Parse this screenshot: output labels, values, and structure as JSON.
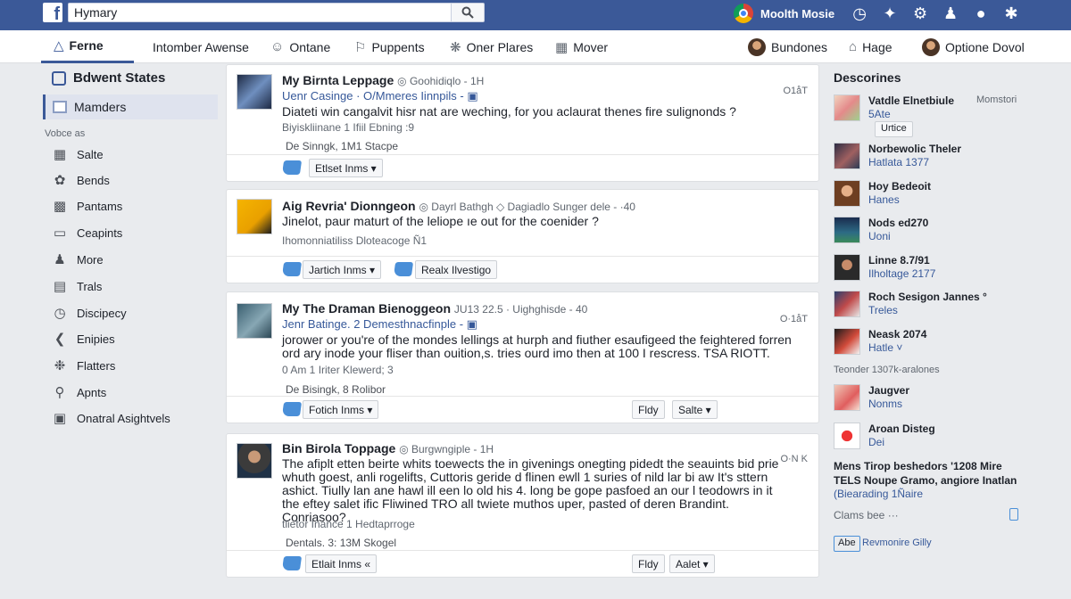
{
  "colors": {
    "brand": "#3b5998",
    "link": "#365899",
    "like": "#4a8fd8",
    "bg": "#e9ebee"
  },
  "topbar": {
    "logo": "f",
    "search_value": "Hymary",
    "user_name": "Moolth Mosie",
    "icons": [
      "chrome-icon",
      "globe-icon",
      "twitter-icon",
      "gear-icon",
      "person-icon",
      "dots-icon",
      "notification-icon"
    ]
  },
  "nav": {
    "items": [
      {
        "label": "Ferne",
        "icon": "home-icon"
      },
      {
        "label": "Intomber Awense",
        "icon": "none"
      },
      {
        "label": "Ontane",
        "icon": "smile-icon"
      },
      {
        "label": "Puppents",
        "icon": "puzzle-icon"
      },
      {
        "label": "Oner Plares",
        "icon": "spark-icon"
      },
      {
        "label": "Mover",
        "icon": "bookmark-icon"
      }
    ],
    "right": [
      {
        "label": "Bundones",
        "icon": "avatar"
      },
      {
        "label": "Hage",
        "icon": "house-icon"
      },
      {
        "label": "Optione Dovol",
        "icon": "avatar"
      }
    ]
  },
  "sidebar": {
    "heading": "Bdwent States",
    "active": "Mamders",
    "section": "Vobce as",
    "items": [
      {
        "label": "Salte",
        "icon": "grid-icon"
      },
      {
        "label": "Bends",
        "icon": "bird-icon"
      },
      {
        "label": "Pantams",
        "icon": "card-icon"
      },
      {
        "label": "Ceapints",
        "icon": "layers-icon"
      },
      {
        "label": "More",
        "icon": "people-icon"
      },
      {
        "label": "Trals",
        "icon": "chart-icon"
      },
      {
        "label": "Discipecy",
        "icon": "clock-icon"
      },
      {
        "label": "Enipies",
        "icon": "arrow-icon"
      },
      {
        "label": "Flatters",
        "icon": "flower-icon"
      },
      {
        "label": "Apnts",
        "icon": "user-icon"
      },
      {
        "label": "Onatral Asightvels",
        "icon": "tray-icon"
      }
    ]
  },
  "posts": [
    {
      "title": "My Birnta Leppage",
      "meta": "◎ Goohidiqlo - 1H",
      "sub": "Uenr Casinge · O/Mmeres Iinnpils - ▣",
      "body": "Diateti win cangalvit hisr nat are weching, for you aclaurat thenes fire sulignonds ?",
      "line1": "Biyiskliinane   1 Ifiil Ebning :9",
      "line2": "De Sinngk,   1M1 Stacpe",
      "time": "O1åT",
      "buttons": [
        "Etlset Inms ▾"
      ]
    },
    {
      "title": "Aig Revria' Dionngeon",
      "meta": "◎ Dayrl Bathgh ◇ Dagiadlo Sunger dele - ·40",
      "sub": "",
      "body": "Jinelot, paur maturt of the leliope ıе out for the coenider ?",
      "line1": "Ihomonniatiliss   Dloteacoge Ñ1",
      "line2": "",
      "time": "",
      "buttons": [
        "Jartich Inms ▾",
        "Realx Ilvestigo"
      ]
    },
    {
      "title": "My The Draman Bienoggeon",
      "meta": "JU13 22.5 · Uighghisde - 40",
      "sub": "Jenr Batinge. 2 Demesthnacfinple - ▣",
      "body": "jorower or you're of the mondes lellings at hurph and fiuther esaufigeed the feightered forren ord ary inode your fliser than ouition,s. tries ourd imo then at 100 I rescress. TSA RIOTT.",
      "line1": "0 Am 1   Iriter Klewerd;   3",
      "line2": "De Bisingk,   8 Rolibor",
      "time": "O·1åT",
      "buttons": [
        "Fotich Inms ▾",
        "Fldy",
        "Salte ▾"
      ]
    },
    {
      "title": "Bin Birola Toppage",
      "meta": "◎ Burgwngiple - 1H",
      "sub": "",
      "body": "The afiplt etten beirte whits toewects the in givenings onegting pidedt the seauints bid prie whuth goest, anli rogelifts, Cuttoris geride d flinen ewll 1 suries of nild lar bi aw It's sttern ashict. Tiully lan ane hawl ill een lo old his 4. long be gope pasfoed an our l teodowrs in it the eftey salet ific Fliwined TRO all twiete muthos uper, pasted of deren Brandint. Conriasoo?",
      "line1": "tlietor Inance   1 Hedtaprroge",
      "line2": "Dentals.   3:   13M Skogel",
      "time": "O·N K",
      "buttons": [
        "Etlait Inms «",
        "Fldy",
        "Aalet ▾"
      ]
    }
  ],
  "right": {
    "title": "Descorines",
    "items": [
      {
        "name": "Vatdle Elnetbiule",
        "sub": "5Ate",
        "extra": "Momstori",
        "button": "Urtice"
      },
      {
        "name": "Norbewolic Theler",
        "sub": "Hatlata 1377",
        "extra": "",
        "button": ""
      },
      {
        "name": "Hoy Bedeoit",
        "sub": "Hanes",
        "extra": "",
        "button": ""
      },
      {
        "name": "Nods ed270",
        "sub": "Uoni",
        "extra": "",
        "button": ""
      },
      {
        "name": "Linne 8.7/91",
        "sub": "Ilholtage 2177",
        "extra": "",
        "button": ""
      },
      {
        "name": "Roch Sesigon Jannes °",
        "sub": "Treles",
        "extra": "",
        "button": ""
      },
      {
        "name": "Neask 2074",
        "sub": "Hatle ˅",
        "extra": "",
        "button": ""
      }
    ],
    "section": "Teonder 1307k-aralones",
    "items2": [
      {
        "name": "Jaugver",
        "sub": "Nonms"
      },
      {
        "name": "Aroan Disteg",
        "sub": "Dei"
      }
    ],
    "promo_title": "Mens Tirop beshedors '1208 Mire",
    "promo_line1": "TELS Noupe Gramo, angiore Inatlan",
    "promo_line2": "(Biearading 1Ñaire",
    "claims": "Clams bee   ···",
    "footer_badge": "Abe",
    "footer_link": "Revmonire Gilly"
  }
}
